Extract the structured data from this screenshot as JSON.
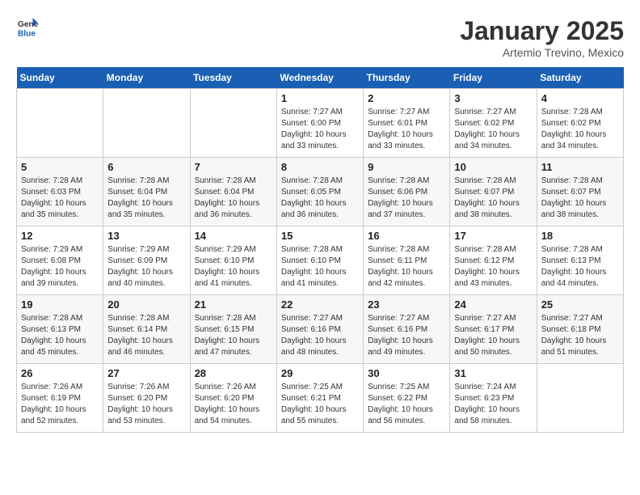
{
  "header": {
    "logo_general": "General",
    "logo_blue": "Blue",
    "title": "January 2025",
    "subtitle": "Artemio Trevino, Mexico"
  },
  "weekdays": [
    "Sunday",
    "Monday",
    "Tuesday",
    "Wednesday",
    "Thursday",
    "Friday",
    "Saturday"
  ],
  "weeks": [
    [
      {
        "day": "",
        "sunrise": "",
        "sunset": "",
        "daylight": ""
      },
      {
        "day": "",
        "sunrise": "",
        "sunset": "",
        "daylight": ""
      },
      {
        "day": "",
        "sunrise": "",
        "sunset": "",
        "daylight": ""
      },
      {
        "day": "1",
        "sunrise": "Sunrise: 7:27 AM",
        "sunset": "Sunset: 6:00 PM",
        "daylight": "Daylight: 10 hours and 33 minutes."
      },
      {
        "day": "2",
        "sunrise": "Sunrise: 7:27 AM",
        "sunset": "Sunset: 6:01 PM",
        "daylight": "Daylight: 10 hours and 33 minutes."
      },
      {
        "day": "3",
        "sunrise": "Sunrise: 7:27 AM",
        "sunset": "Sunset: 6:02 PM",
        "daylight": "Daylight: 10 hours and 34 minutes."
      },
      {
        "day": "4",
        "sunrise": "Sunrise: 7:28 AM",
        "sunset": "Sunset: 6:02 PM",
        "daylight": "Daylight: 10 hours and 34 minutes."
      }
    ],
    [
      {
        "day": "5",
        "sunrise": "Sunrise: 7:28 AM",
        "sunset": "Sunset: 6:03 PM",
        "daylight": "Daylight: 10 hours and 35 minutes."
      },
      {
        "day": "6",
        "sunrise": "Sunrise: 7:28 AM",
        "sunset": "Sunset: 6:04 PM",
        "daylight": "Daylight: 10 hours and 35 minutes."
      },
      {
        "day": "7",
        "sunrise": "Sunrise: 7:28 AM",
        "sunset": "Sunset: 6:04 PM",
        "daylight": "Daylight: 10 hours and 36 minutes."
      },
      {
        "day": "8",
        "sunrise": "Sunrise: 7:28 AM",
        "sunset": "Sunset: 6:05 PM",
        "daylight": "Daylight: 10 hours and 36 minutes."
      },
      {
        "day": "9",
        "sunrise": "Sunrise: 7:28 AM",
        "sunset": "Sunset: 6:06 PM",
        "daylight": "Daylight: 10 hours and 37 minutes."
      },
      {
        "day": "10",
        "sunrise": "Sunrise: 7:28 AM",
        "sunset": "Sunset: 6:07 PM",
        "daylight": "Daylight: 10 hours and 38 minutes."
      },
      {
        "day": "11",
        "sunrise": "Sunrise: 7:28 AM",
        "sunset": "Sunset: 6:07 PM",
        "daylight": "Daylight: 10 hours and 38 minutes."
      }
    ],
    [
      {
        "day": "12",
        "sunrise": "Sunrise: 7:29 AM",
        "sunset": "Sunset: 6:08 PM",
        "daylight": "Daylight: 10 hours and 39 minutes."
      },
      {
        "day": "13",
        "sunrise": "Sunrise: 7:29 AM",
        "sunset": "Sunset: 6:09 PM",
        "daylight": "Daylight: 10 hours and 40 minutes."
      },
      {
        "day": "14",
        "sunrise": "Sunrise: 7:29 AM",
        "sunset": "Sunset: 6:10 PM",
        "daylight": "Daylight: 10 hours and 41 minutes."
      },
      {
        "day": "15",
        "sunrise": "Sunrise: 7:28 AM",
        "sunset": "Sunset: 6:10 PM",
        "daylight": "Daylight: 10 hours and 41 minutes."
      },
      {
        "day": "16",
        "sunrise": "Sunrise: 7:28 AM",
        "sunset": "Sunset: 6:11 PM",
        "daylight": "Daylight: 10 hours and 42 minutes."
      },
      {
        "day": "17",
        "sunrise": "Sunrise: 7:28 AM",
        "sunset": "Sunset: 6:12 PM",
        "daylight": "Daylight: 10 hours and 43 minutes."
      },
      {
        "day": "18",
        "sunrise": "Sunrise: 7:28 AM",
        "sunset": "Sunset: 6:13 PM",
        "daylight": "Daylight: 10 hours and 44 minutes."
      }
    ],
    [
      {
        "day": "19",
        "sunrise": "Sunrise: 7:28 AM",
        "sunset": "Sunset: 6:13 PM",
        "daylight": "Daylight: 10 hours and 45 minutes."
      },
      {
        "day": "20",
        "sunrise": "Sunrise: 7:28 AM",
        "sunset": "Sunset: 6:14 PM",
        "daylight": "Daylight: 10 hours and 46 minutes."
      },
      {
        "day": "21",
        "sunrise": "Sunrise: 7:28 AM",
        "sunset": "Sunset: 6:15 PM",
        "daylight": "Daylight: 10 hours and 47 minutes."
      },
      {
        "day": "22",
        "sunrise": "Sunrise: 7:27 AM",
        "sunset": "Sunset: 6:16 PM",
        "daylight": "Daylight: 10 hours and 48 minutes."
      },
      {
        "day": "23",
        "sunrise": "Sunrise: 7:27 AM",
        "sunset": "Sunset: 6:16 PM",
        "daylight": "Daylight: 10 hours and 49 minutes."
      },
      {
        "day": "24",
        "sunrise": "Sunrise: 7:27 AM",
        "sunset": "Sunset: 6:17 PM",
        "daylight": "Daylight: 10 hours and 50 minutes."
      },
      {
        "day": "25",
        "sunrise": "Sunrise: 7:27 AM",
        "sunset": "Sunset: 6:18 PM",
        "daylight": "Daylight: 10 hours and 51 minutes."
      }
    ],
    [
      {
        "day": "26",
        "sunrise": "Sunrise: 7:26 AM",
        "sunset": "Sunset: 6:19 PM",
        "daylight": "Daylight: 10 hours and 52 minutes."
      },
      {
        "day": "27",
        "sunrise": "Sunrise: 7:26 AM",
        "sunset": "Sunset: 6:20 PM",
        "daylight": "Daylight: 10 hours and 53 minutes."
      },
      {
        "day": "28",
        "sunrise": "Sunrise: 7:26 AM",
        "sunset": "Sunset: 6:20 PM",
        "daylight": "Daylight: 10 hours and 54 minutes."
      },
      {
        "day": "29",
        "sunrise": "Sunrise: 7:25 AM",
        "sunset": "Sunset: 6:21 PM",
        "daylight": "Daylight: 10 hours and 55 minutes."
      },
      {
        "day": "30",
        "sunrise": "Sunrise: 7:25 AM",
        "sunset": "Sunset: 6:22 PM",
        "daylight": "Daylight: 10 hours and 56 minutes."
      },
      {
        "day": "31",
        "sunrise": "Sunrise: 7:24 AM",
        "sunset": "Sunset: 6:23 PM",
        "daylight": "Daylight: 10 hours and 58 minutes."
      },
      {
        "day": "",
        "sunrise": "",
        "sunset": "",
        "daylight": ""
      }
    ]
  ]
}
